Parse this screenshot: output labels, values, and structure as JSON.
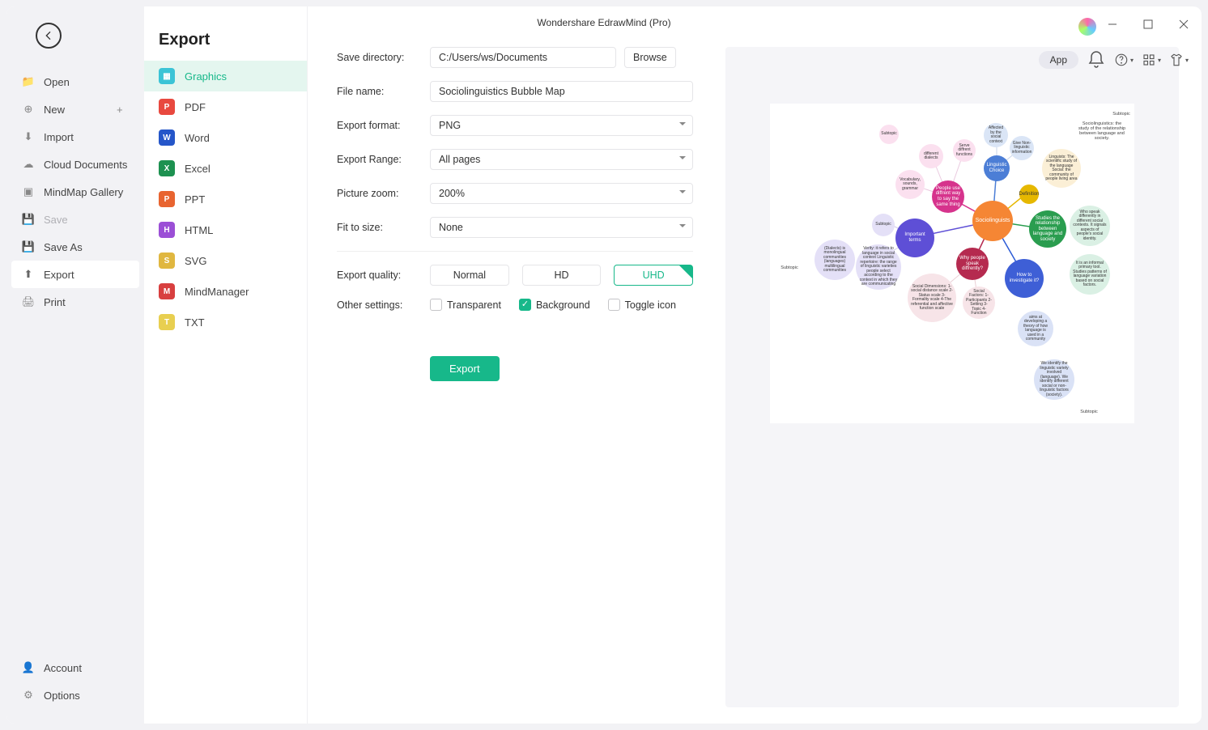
{
  "title": "Wondershare EdrawMind (Pro)",
  "toolbar": {
    "app_label": "App"
  },
  "nav": {
    "open": "Open",
    "new": "New",
    "import": "Import",
    "cloud": "Cloud Documents",
    "gallery": "MindMap Gallery",
    "save": "Save",
    "saveas": "Save As",
    "export": "Export",
    "print": "Print",
    "account": "Account",
    "options": "Options"
  },
  "sidebar2": {
    "title": "Export",
    "items": {
      "graphics": "Graphics",
      "pdf": "PDF",
      "word": "Word",
      "excel": "Excel",
      "ppt": "PPT",
      "html": "HTML",
      "svg": "SVG",
      "mm": "MindManager",
      "txt": "TXT"
    }
  },
  "form": {
    "save_dir_label": "Save directory:",
    "save_dir_value": "C:/Users/ws/Documents",
    "browse": "Browse",
    "filename_label": "File name:",
    "filename_value": "Sociolinguistics Bubble Map",
    "format_label": "Export format:",
    "format_value": "PNG",
    "range_label": "Export Range:",
    "range_value": "All pages",
    "zoom_label": "Picture zoom:",
    "zoom_value": "200%",
    "fit_label": "Fit to size:",
    "fit_value": "None",
    "quality_label": "Export quality:",
    "q_normal": "Normal",
    "q_hd": "HD",
    "q_uhd": "UHD",
    "other_label": "Other settings:",
    "transparent": "Transparent",
    "background": "Background",
    "toggle_icon": "Toggle icon",
    "export_btn": "Export"
  },
  "preview": {
    "center": "Sociolinguists",
    "green": "Studies the relationship between language and society",
    "blue_top": "Linguistic Choice",
    "yellow": "Definition",
    "magenta": "People use diffrent way to say the same thing",
    "purple": "Important terms",
    "crimson": "Why people speak diffrently?",
    "royal": "How to investigate it?",
    "b_vocab": "Vocabulary, sounds, grammar",
    "b_dialects": "different dialects",
    "b_func": "Serve diffrent functions",
    "b_affect": "Affected by the social context",
    "b_linginfo": "Give Non-linguistic information",
    "b_social": "Social Dimensions: 1-social distance scale 2- Status scale 3-Formality scale 4-The referential and affective function scale",
    "b_factors": "Social Factors: 1-Participants 2-Setting 3-Topic 4- Function",
    "t_subtopic1": "Subtopic",
    "t_subtopic2": "Subtopic",
    "t_subtopic3": "Subtopic",
    "t_subtopic4": "Subtopic",
    "t_subtopic5": "Subtopic",
    "t_def": "Sociolinguistics: the study of the relationship between language and society.",
    "t_linguists": "Linguists: The scientific study of the language Social: the community of people living area",
    "t_who": "Who speak differently in different social contexts. It signals aspects of people's social identity.",
    "t_unformal": "It is an informal primary tool. Studies patterns of language variation based on social factors.",
    "t_aims": "aims at developing a theory of how language is used in a community",
    "t_identify": "We identify the linguistic variety involved (language). We identify different social or non-linguistic factors (society).",
    "t_dialects": "(Dialects) is monolingual communities (languages) multilingual communities",
    "t_verity": "Verity: it refers to language in social context Linguistic repertoire: the range of linguistic varieties people select according to the context in which they are communicating"
  }
}
